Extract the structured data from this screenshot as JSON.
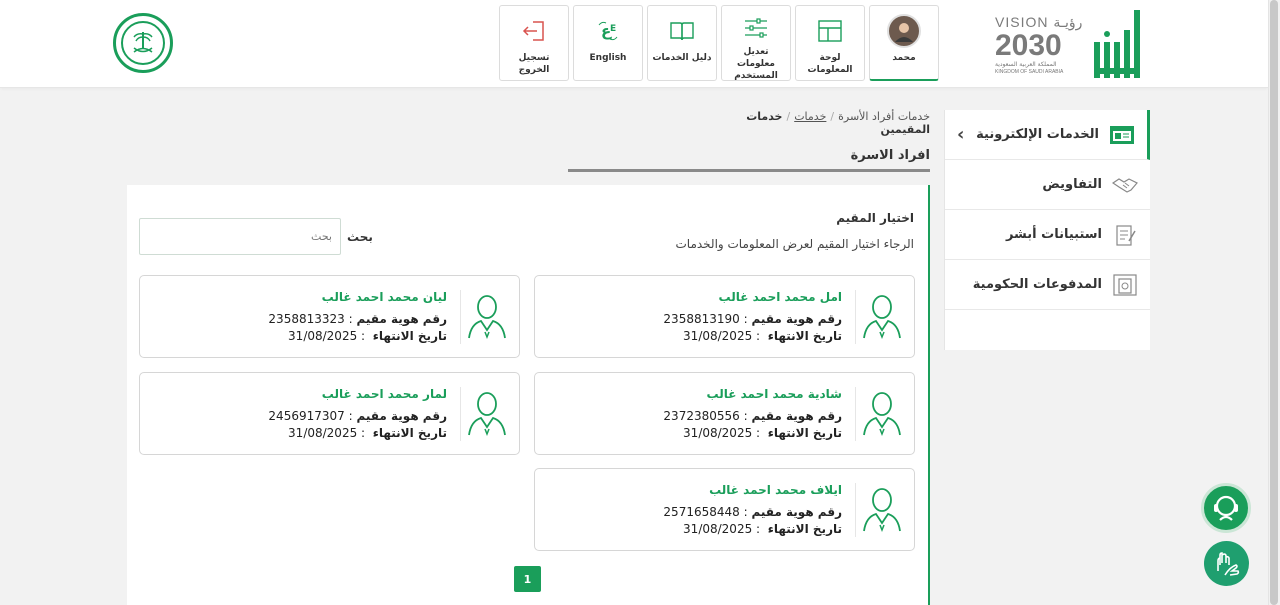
{
  "header": {
    "tiles": [
      {
        "label": "تسجيل الخروج",
        "icon": "logout-icon"
      },
      {
        "label": "English",
        "icon": "language-icon"
      },
      {
        "label": "دليل الخدمات",
        "icon": "book-icon"
      },
      {
        "label": "تعديل معلومات المستخدم",
        "icon": "settings-sliders-icon"
      },
      {
        "label": "لوحة المعلومات",
        "icon": "dashboard-icon"
      },
      {
        "label": "محمد",
        "icon": "avatar"
      }
    ],
    "vision": {
      "word": "VISION",
      "arabic_word": "رؤيـة",
      "year": "2030",
      "kingdom_ar": "المملكة العربية السعودية",
      "kingdom_en": "KINGDOM OF SAUDI ARABIA"
    }
  },
  "sidebar": {
    "items": [
      {
        "label": "الخدمات الإلكترونية",
        "icon": "eservices-icon"
      },
      {
        "label": "التفاويض",
        "icon": "handshake-icon"
      },
      {
        "label": "استبيانات أبشر",
        "icon": "survey-icon"
      },
      {
        "label": "المدفوعات الحكومية",
        "icon": "payment-icon"
      }
    ]
  },
  "breadcrumb": {
    "item1": "خدمات أفراد الأسرة",
    "item2": "خدمات",
    "item3": "خدمات المقيمين"
  },
  "page": {
    "title": "افراد الاسرة",
    "choose_title": "اختيار المقيم",
    "choose_hint": "الرجاء اختيار المقيم لعرض المعلومات والخدمات",
    "search_label": "بحث",
    "search_placeholder": "بحث"
  },
  "labels": {
    "id_label": "رقم هوية مقيم",
    "expiry_label": "تاريخ الانتهاء"
  },
  "residents": [
    {
      "name": "امل محمد احمد غالب",
      "id": "2358813190",
      "expiry": "31/08/2025"
    },
    {
      "name": "ليان محمد احمد غالب",
      "id": "2358813323",
      "expiry": "31/08/2025"
    },
    {
      "name": "شادية محمد احمد غالب",
      "id": "2372380556",
      "expiry": "31/08/2025"
    },
    {
      "name": "لمار محمد احمد غالب",
      "id": "2456917307",
      "expiry": "31/08/2025"
    },
    {
      "name": "ايلاف محمد احمد غالب",
      "id": "2571658448",
      "expiry": "31/08/2025"
    }
  ],
  "pagination": {
    "current": "1"
  },
  "colors": {
    "accent": "#1a9e5a"
  }
}
